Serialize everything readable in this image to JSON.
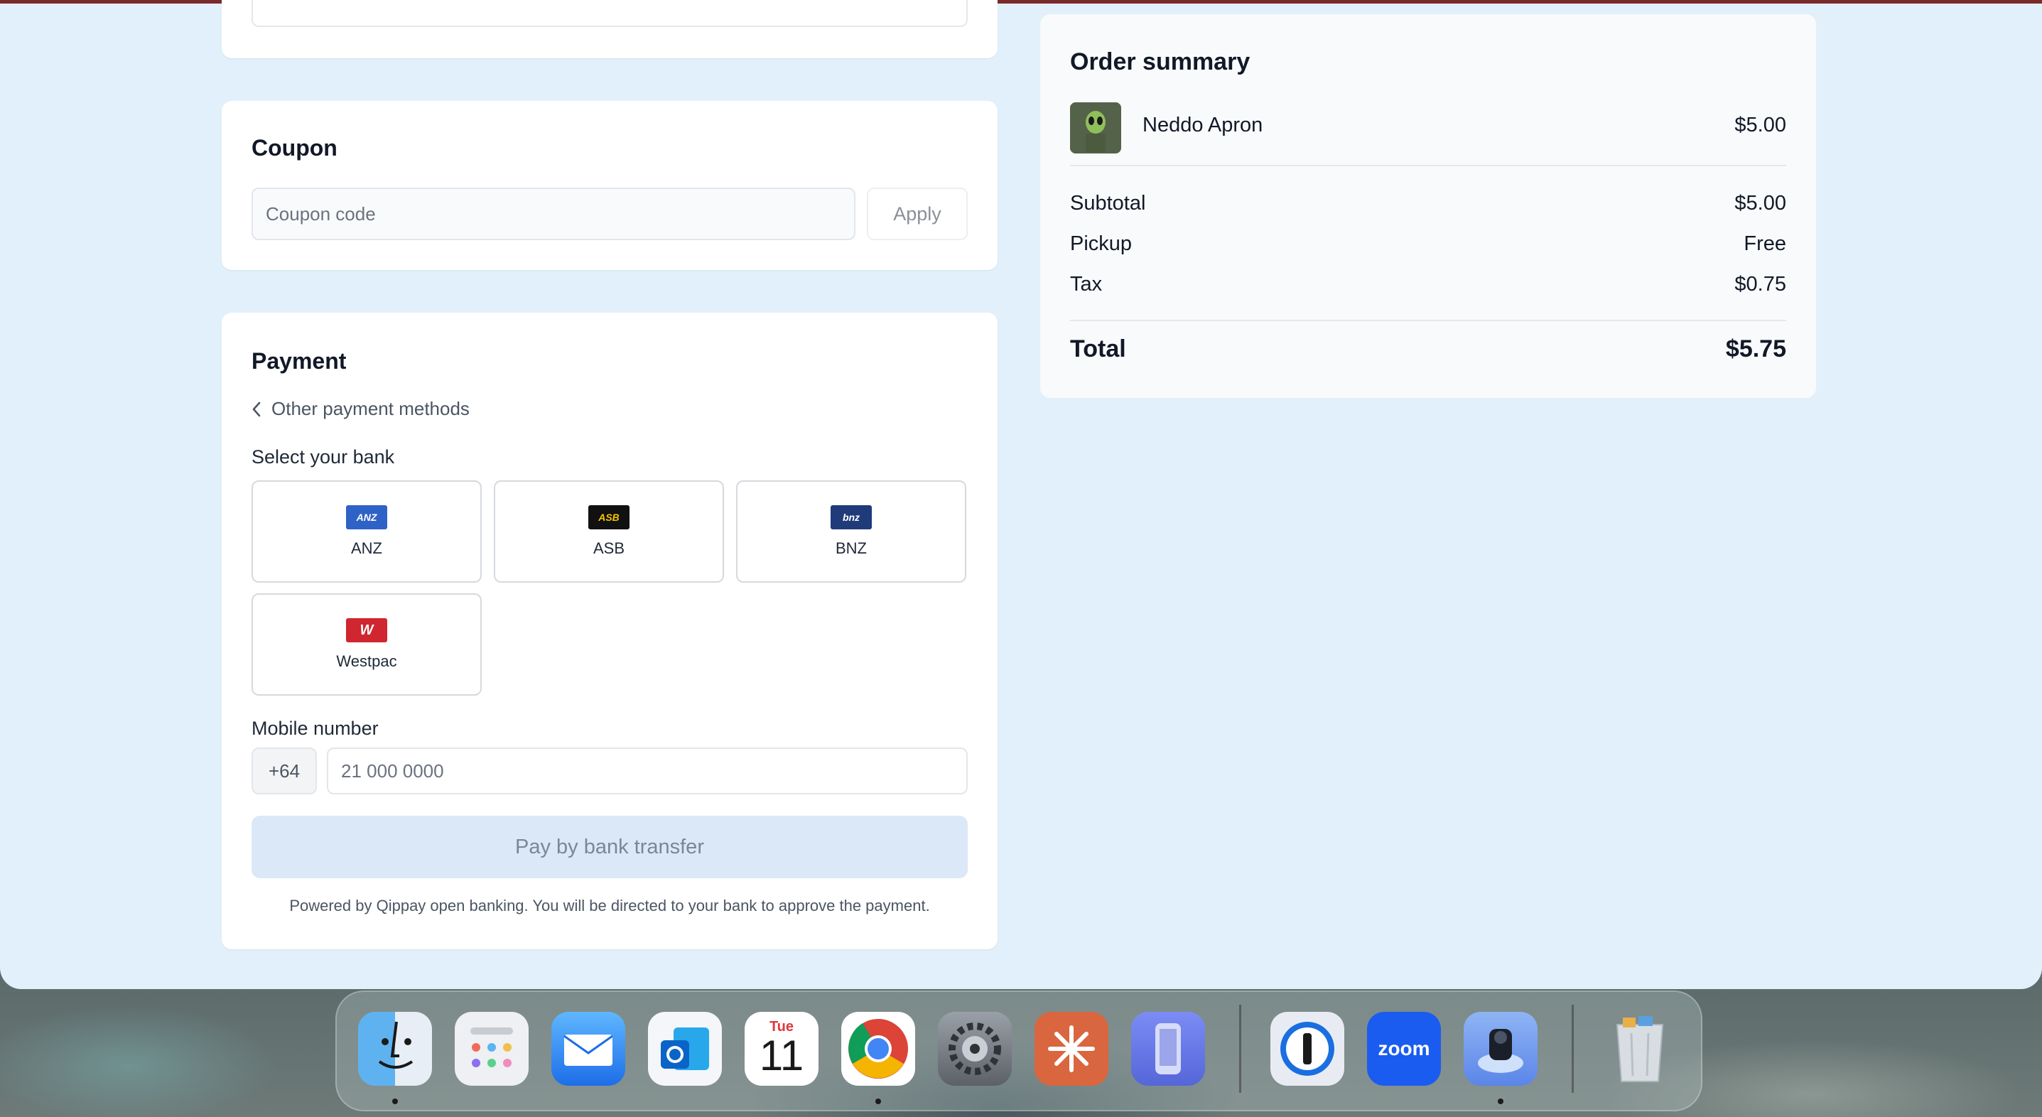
{
  "coupon": {
    "title": "Coupon",
    "placeholder": "Coupon code",
    "apply_label": "Apply"
  },
  "payment": {
    "title": "Payment",
    "back_label": "Other payment methods",
    "select_bank_label": "Select your bank",
    "banks": [
      {
        "name": "ANZ",
        "logo_text": "ANZ",
        "color": "#2f62c7"
      },
      {
        "name": "ASB",
        "logo_text": "ASB",
        "color": "#111111"
      },
      {
        "name": "BNZ",
        "logo_text": "bnz",
        "color": "#1f3b7a"
      },
      {
        "name": "Westpac",
        "logo_text": "W",
        "color": "#d0262f"
      }
    ],
    "mobile_label": "Mobile number",
    "mobile_prefix": "+64",
    "mobile_placeholder": "21 000 0000",
    "pay_button_label": "Pay by bank transfer",
    "footnote": "Powered by Qippay open banking. You will be directed to your bank to approve the payment."
  },
  "summary": {
    "title": "Order summary",
    "item": {
      "name": "Neddo Apron",
      "price": "$5.00"
    },
    "subtotal_label": "Subtotal",
    "subtotal_value": "$5.00",
    "pickup_label": "Pickup",
    "pickup_value": "Free",
    "tax_label": "Tax",
    "tax_value": "$0.75",
    "total_label": "Total",
    "total_value": "$5.75"
  },
  "dock": {
    "calendar_day": "Tue",
    "calendar_date": "11",
    "zoom_label": "zoom",
    "apps": [
      "finder-icon",
      "launchpad-icon",
      "mail-icon",
      "outlook-icon",
      "calendar-icon",
      "chrome-icon",
      "system-settings-icon",
      "claude-icon",
      "simulator-icon",
      "1password-icon",
      "zoom-icon",
      "preview-icon",
      "trash-icon"
    ]
  }
}
